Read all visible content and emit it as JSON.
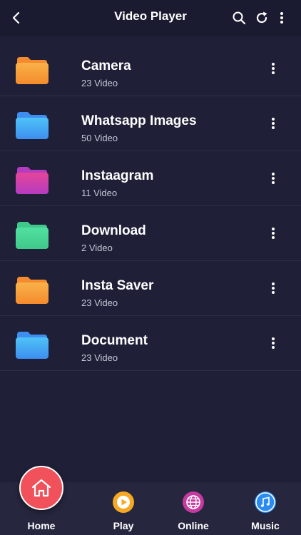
{
  "header": {
    "title": "Video Player"
  },
  "folders": [
    {
      "name": "Camera",
      "count": "23 Video",
      "color_top": "#f8b24a",
      "color_bottom": "#f58b2c"
    },
    {
      "name": "Whatsapp Images",
      "count": "50 Video",
      "color_top": "#4fc3f7",
      "color_bottom": "#3d8ef0"
    },
    {
      "name": "Instaagram",
      "count": "11 Video",
      "color_top": "#e64597",
      "color_bottom": "#b43cc1"
    },
    {
      "name": "Download",
      "count": "2 Video",
      "color_top": "#52e0a0",
      "color_bottom": "#3ec98a"
    },
    {
      "name": "Insta Saver",
      "count": "23 Video",
      "color_top": "#f8b24a",
      "color_bottom": "#f58b2c"
    },
    {
      "name": "Document",
      "count": "23 Video",
      "color_top": "#4fc3f7",
      "color_bottom": "#3d8ef0"
    }
  ],
  "nav": {
    "home": "Home",
    "play": "Play",
    "online": "Online",
    "music": "Music"
  },
  "colors": {
    "background": "#1f2038",
    "topbar": "#1a1b30",
    "bottom_nav": "#26273f",
    "home_accent": "#f0515a",
    "play_accent": "#f7a823",
    "online_accent": "#c63aa0",
    "music_accent": "#2a8cf0"
  }
}
